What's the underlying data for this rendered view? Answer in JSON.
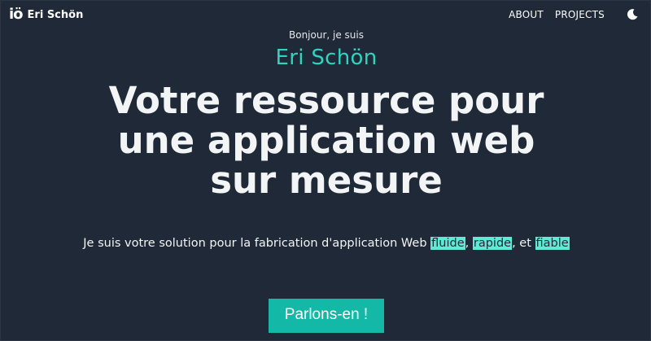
{
  "header": {
    "logo_text": "iö",
    "brand_name": "Eri Schön",
    "nav": [
      {
        "label": "ABOUT"
      },
      {
        "label": "PROJECTS"
      }
    ],
    "theme_toggle_icon": "moon-icon"
  },
  "hero": {
    "greeting": "Bonjour, je suis",
    "name": "Eri Schön",
    "headline": "Votre ressource pour une application web sur mesure",
    "tagline_prefix": "Je suis votre solution pour la fabrication d'application Web ",
    "highlight_1": "fluide",
    "sep_1": ", ",
    "highlight_2": "rapide",
    "sep_2": ", et ",
    "highlight_3": "fiable",
    "cta_label": "Parlons-en !"
  },
  "colors": {
    "background": "#1f2937",
    "accent": "#2dd4bf",
    "highlight": "#5eead4",
    "button": "#14b8a6"
  }
}
